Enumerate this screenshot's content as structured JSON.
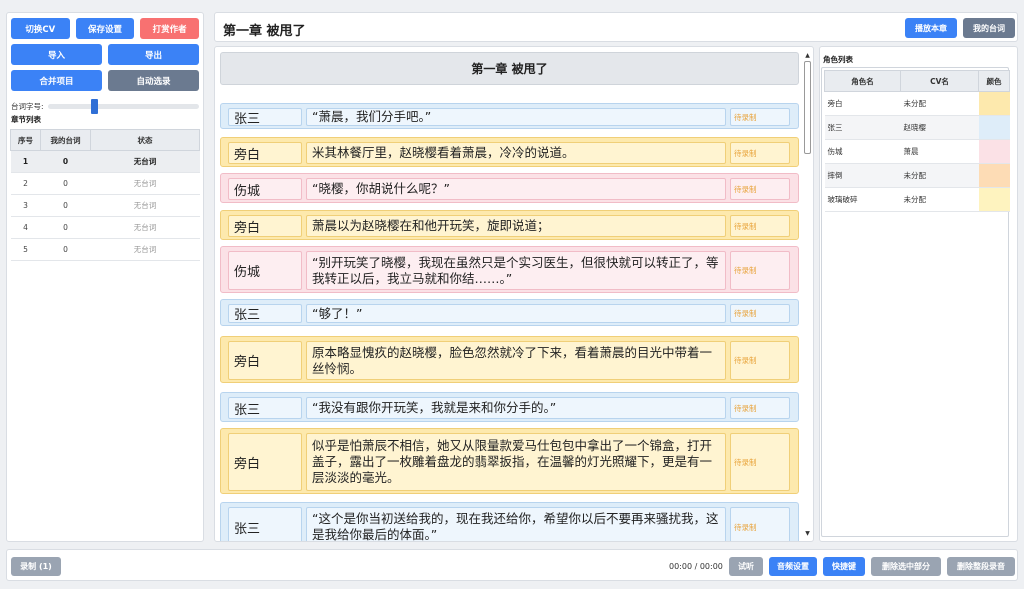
{
  "left": {
    "buttons_row1": [
      "切换CV",
      "保存设置",
      "打赏作者"
    ],
    "buttons_row2": [
      "导入",
      "导出"
    ],
    "buttons_row3": [
      "合并项目",
      "自动选录"
    ],
    "slider_label": "台词字号:",
    "slider_value": 0.3,
    "chapter_list_title": "章节列表",
    "columns": [
      "序号",
      "我的台词",
      "状态"
    ],
    "rows": [
      {
        "no": "1",
        "mine": "0",
        "status": "无台词"
      },
      {
        "no": "2",
        "mine": "0",
        "status": "无台词"
      },
      {
        "no": "3",
        "mine": "0",
        "status": "无台词"
      },
      {
        "no": "4",
        "mine": "0",
        "status": "无台词"
      },
      {
        "no": "5",
        "mine": "0",
        "status": "无台词"
      }
    ]
  },
  "header": {
    "title": "第一章 被甩了",
    "play_label": "播放本章",
    "mine_label": "我的台词"
  },
  "script": {
    "chapter_banner": "第一章 被甩了",
    "status_label": "待录制",
    "lines": [
      {
        "cast": "张三",
        "text": "“萧晨，我们分手吧。”",
        "color": "blue"
      },
      {
        "cast": "旁白",
        "text": "米其林餐厅里，赵晓樱看着萧晨，冷冷的说道。",
        "color": "yellow"
      },
      {
        "cast": "伤城",
        "text": "“晓樱，你胡说什么呢？”",
        "color": "pink"
      },
      {
        "cast": "旁白",
        "text": "萧晨以为赵晓樱在和他开玩笑，旋即说道；",
        "color": "yellow"
      },
      {
        "cast": "伤城",
        "text": "“别开玩笑了晓樱，我现在虽然只是个实习医生，但很快就可以转正了，等我转正以后，我立马就和你结……。”",
        "color": "pink"
      },
      {
        "cast": "张三",
        "text": "“够了！”",
        "color": "blue"
      },
      {
        "cast": "旁白",
        "text": "原本略显愧疚的赵晓樱，脸色忽然就冷了下来，看着萧晨的目光中带着一丝怜悯。",
        "color": "yellow"
      },
      {
        "cast": "张三",
        "text": "“我没有跟你开玩笑，我就是来和你分手的。”",
        "color": "blue"
      },
      {
        "cast": "旁白",
        "text": "似乎是怕萧辰不相信，她又从限量款爱马仕包包中拿出了一个锦盒，打开盖子，露出了一枚雕着盘龙的翡翠扳指，在温馨的灯光照耀下，更是有一层淡淡的毫光。",
        "color": "yellow"
      },
      {
        "cast": "张三",
        "text": "“这个是你当初送给我的，现在我还给你，希望你以后不要再来骚扰我，这是我给你最后的体面。”",
        "color": "blue"
      }
    ]
  },
  "roles": {
    "title": "角色列表",
    "columns": [
      "角色名",
      "CV名",
      "颜色"
    ],
    "rows": [
      {
        "name": "旁白",
        "cv": "未分配",
        "color": "#fde9ad"
      },
      {
        "name": "张三",
        "cv": "赵晓樱",
        "color": "#deedf9"
      },
      {
        "name": "伤城",
        "cv": "萧晨",
        "color": "#fbe1e6"
      },
      {
        "name": "摔倒",
        "cv": "未分配",
        "color": "#fddcb5"
      },
      {
        "name": "玻璃破碎",
        "cv": "未分配",
        "color": "#fef3bf"
      }
    ]
  },
  "footer": {
    "record_label": "录制 (1)",
    "time": "00:00 / 00:00",
    "listen_label": "试听",
    "audio_settings_label": "音频设置",
    "shortcut_label": "快捷键",
    "delete_selected_label": "删除选中部分",
    "delete_all_label": "删除整段录音"
  },
  "colors": {
    "blue_button": "#3b82f6",
    "red_button": "#f87171",
    "gray_button": "#6b7a90",
    "disabled_button": "#9aa4b2",
    "pending_status": "#e8a33a"
  }
}
